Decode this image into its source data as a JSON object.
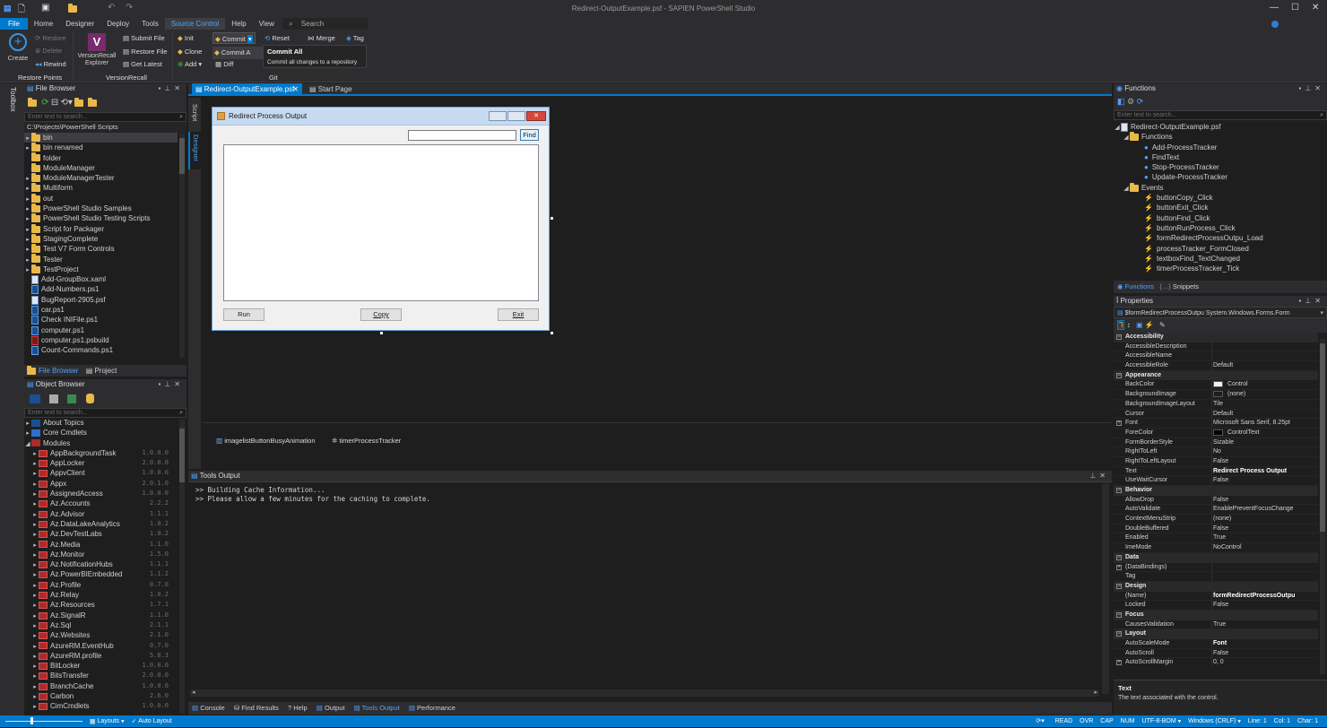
{
  "title_bar": {
    "title": "Redirect-OutputExample.psf - SAPIEN PowerShell Studio"
  },
  "menu": [
    "File",
    "Home",
    "Designer",
    "Deploy",
    "Tools",
    "Source Control",
    "Help",
    "View"
  ],
  "menu_search": "Search",
  "ribbon": {
    "restore_points": {
      "create": "Create",
      "restore": "Restore",
      "delete": "Delete",
      "rewind": "Rewind",
      "group": "Restore Points"
    },
    "versionrecall": {
      "explorer": "VersionRecall Explorer",
      "submit": "Submit File",
      "restore": "Restore File",
      "latest": "Get Latest",
      "group": "VersionRecall"
    },
    "git": {
      "init": "Init",
      "clone": "Clone",
      "add": "Add",
      "commit": "Commit",
      "reset": "Reset",
      "merge": "Merge",
      "tag": "Tag",
      "commit_all": "Commit A",
      "diff": "Diff",
      "group": "Git"
    },
    "dropdown": {
      "title": "Commit All",
      "desc": "Commit all changes to a repository"
    }
  },
  "toolbox_label": "Toolbox",
  "file_browser": {
    "title": "File Browser",
    "search": "Enter text to search...",
    "path": "C:\\Projects\\PowerShell Scripts",
    "items": [
      {
        "n": "bin",
        "t": "folder",
        "e": true,
        "sel": true
      },
      {
        "n": "bin renamed",
        "t": "folder",
        "e": true
      },
      {
        "n": "folder",
        "t": "folder",
        "e": false
      },
      {
        "n": "ModuleManager",
        "t": "folder",
        "e": false
      },
      {
        "n": "ModuleManagerTester",
        "t": "folder",
        "e": true
      },
      {
        "n": "Multiform",
        "t": "folder",
        "e": true
      },
      {
        "n": "out",
        "t": "folder",
        "e": true
      },
      {
        "n": "PowerShell Studio Samples",
        "t": "folder",
        "e": true
      },
      {
        "n": "PowerShell Studio Testing Scripts",
        "t": "folder",
        "e": true
      },
      {
        "n": "Script for Packager",
        "t": "folder",
        "e": true
      },
      {
        "n": "StagingComplete",
        "t": "folder",
        "e": true
      },
      {
        "n": "Test V7 Form Controls",
        "t": "folder",
        "e": true
      },
      {
        "n": "Tester",
        "t": "folder",
        "e": true
      },
      {
        "n": "TestProject",
        "t": "folder",
        "e": true
      },
      {
        "n": "Add-GroupBox.xaml",
        "t": "file"
      },
      {
        "n": "Add-Numbers.ps1",
        "t": "ps"
      },
      {
        "n": "BugReport-2905.psf",
        "t": "file"
      },
      {
        "n": "car.ps1",
        "t": "ps"
      },
      {
        "n": "Check INIFile.ps1",
        "t": "ps"
      },
      {
        "n": "computer.ps1",
        "t": "ps"
      },
      {
        "n": "computer.ps1.psbuild",
        "t": "red"
      },
      {
        "n": "Count-Commands.ps1",
        "t": "ps"
      }
    ],
    "tabs": [
      "File Browser",
      "Project"
    ]
  },
  "object_browser": {
    "title": "Object Browser",
    "search": "Enter text to search...",
    "top": [
      "About Topics",
      "Core Cmdlets",
      "Modules"
    ],
    "modules": [
      {
        "n": "AppBackgroundTask",
        "v": "1.0.0.0"
      },
      {
        "n": "AppLocker",
        "v": "2.0.0.0"
      },
      {
        "n": "AppvClient",
        "v": "1.0.0.0"
      },
      {
        "n": "Appx",
        "v": "2.0.1.0"
      },
      {
        "n": "AssignedAccess",
        "v": "1.0.0.0"
      },
      {
        "n": "Az.Accounts",
        "v": "2.2.2"
      },
      {
        "n": "Az.Advisor",
        "v": "1.1.1"
      },
      {
        "n": "Az.DataLakeAnalytics",
        "v": "1.0.2"
      },
      {
        "n": "Az.DevTestLabs",
        "v": "1.0.2"
      },
      {
        "n": "Az.Media",
        "v": "1.1.0"
      },
      {
        "n": "Az.Monitor",
        "v": "1.5.0"
      },
      {
        "n": "Az.NotificationHubs",
        "v": "1.1.1"
      },
      {
        "n": "Az.PowerBIEmbedded",
        "v": "1.1.2"
      },
      {
        "n": "Az.Profile",
        "v": "0.7.0"
      },
      {
        "n": "Az.Relay",
        "v": "1.0.2"
      },
      {
        "n": "Az.Resources",
        "v": "1.7.1"
      },
      {
        "n": "Az.SignalR",
        "v": "1.1.0"
      },
      {
        "n": "Az.Sql",
        "v": "2.1.1"
      },
      {
        "n": "Az.Websites",
        "v": "2.1.0"
      },
      {
        "n": "AzureRM.EventHub",
        "v": "0.7.0"
      },
      {
        "n": "AzureRM.profile",
        "v": "5.8.3"
      },
      {
        "n": "BitLocker",
        "v": "1.0.0.0"
      },
      {
        "n": "BitsTransfer",
        "v": "2.0.0.0"
      },
      {
        "n": "BranchCache",
        "v": "1.0.0.0"
      },
      {
        "n": "Carbon",
        "v": "2.6.0"
      },
      {
        "n": "CimCmdlets",
        "v": "1.0.0.0"
      }
    ]
  },
  "doc_tabs": [
    "Redirect-OutputExample.psf",
    "Start Page"
  ],
  "side_tabs": [
    "Script",
    "Designer"
  ],
  "form": {
    "title": "Redirect Process Output",
    "find": "Find",
    "run": "Run",
    "copy": "Copy",
    "exit": "Exit"
  },
  "components": [
    "imagelistButtonBusyAnimation",
    "timerProcessTracker"
  ],
  "tools_output": {
    "title": "Tools Output",
    "lines": [
      ">> Building Cache Information...",
      ">> Please allow a few minutes for the caching to complete."
    ]
  },
  "bottom_tabs": [
    "Console",
    "Find Results",
    "Help",
    "Output",
    "Tools Output",
    "Performance"
  ],
  "functions": {
    "title": "Functions",
    "search": "Enter text to search...",
    "file": "Redirect-OutputExample.psf",
    "groups": [
      {
        "name": "Functions",
        "items": [
          "Add-ProcessTracker",
          "FindText",
          "Stop-ProcessTracker",
          "Update-ProcessTracker"
        ]
      },
      {
        "name": "Events",
        "items": [
          "buttonCopy_Click",
          "buttonExit_Click",
          "buttonFind_Click",
          "buttonRunProcess_Click",
          "formRedirectProcessOutpu_Load",
          "processTracker_FormClosed",
          "textboxFind_TextChanged",
          "timerProcessTracker_Tick"
        ]
      }
    ],
    "tabs": [
      "Functions",
      "Snippets"
    ]
  },
  "properties": {
    "title": "Properties",
    "object": "$formRedirectProcessOutpu System.Windows.Forms.Form",
    "rows": [
      {
        "c": "Accessibility"
      },
      {
        "n": "AccessibleDescription",
        "v": ""
      },
      {
        "n": "AccessibleName",
        "v": ""
      },
      {
        "n": "AccessibleRole",
        "v": "Default"
      },
      {
        "c": "Appearance"
      },
      {
        "n": "BackColor",
        "v": "Control",
        "sw": "#f0f0f0"
      },
      {
        "n": "BackgroundImage",
        "v": "(none)",
        "sw": "#1e1e1e"
      },
      {
        "n": "BackgroundImageLayout",
        "v": "Tile"
      },
      {
        "n": "Cursor",
        "v": "Default"
      },
      {
        "n": "Font",
        "v": "Microsoft Sans Serif, 8.25pt",
        "x": true
      },
      {
        "n": "ForeColor",
        "v": "ControlText",
        "sw": "#000000"
      },
      {
        "n": "FormBorderStyle",
        "v": "Sizable"
      },
      {
        "n": "RightToLeft",
        "v": "No"
      },
      {
        "n": "RightToLeftLayout",
        "v": "False"
      },
      {
        "n": "Text",
        "v": "Redirect Process Output",
        "b": true
      },
      {
        "n": "UseWaitCursor",
        "v": "False"
      },
      {
        "c": "Behavior"
      },
      {
        "n": "AllowDrop",
        "v": "False"
      },
      {
        "n": "AutoValidate",
        "v": "EnablePreventFocusChange"
      },
      {
        "n": "ContextMenuStrip",
        "v": "(none)"
      },
      {
        "n": "DoubleBuffered",
        "v": "False"
      },
      {
        "n": "Enabled",
        "v": "True"
      },
      {
        "n": "ImeMode",
        "v": "NoControl"
      },
      {
        "c": "Data"
      },
      {
        "n": "(DataBindings)",
        "v": "",
        "x": true
      },
      {
        "n": "Tag",
        "v": ""
      },
      {
        "c": "Design"
      },
      {
        "n": "(Name)",
        "v": "formRedirectProcessOutpu",
        "b": true
      },
      {
        "n": "Locked",
        "v": "False"
      },
      {
        "c": "Focus"
      },
      {
        "n": "CausesValidation",
        "v": "True"
      },
      {
        "c": "Layout"
      },
      {
        "n": "AutoScaleMode",
        "v": "Font",
        "b": true
      },
      {
        "n": "AutoScroll",
        "v": "False"
      },
      {
        "n": "AutoScrollMargin",
        "v": "0, 0",
        "x": true
      }
    ],
    "desc_title": "Text",
    "desc": "The text associated with the control."
  },
  "status": {
    "layouts": "Layouts",
    "autolayout": "Auto Layout",
    "read": "READ",
    "ovr": "OVR",
    "cap": "CAP",
    "num": "NUM",
    "encoding": "UTF-8-BOM",
    "lineend": "Windows (CRLF)",
    "line": "Line: 1",
    "col": "Col: 1",
    "char": "Char: 1"
  },
  "colors": {
    "accent": "#007acc",
    "status_bar": "#007acc"
  }
}
